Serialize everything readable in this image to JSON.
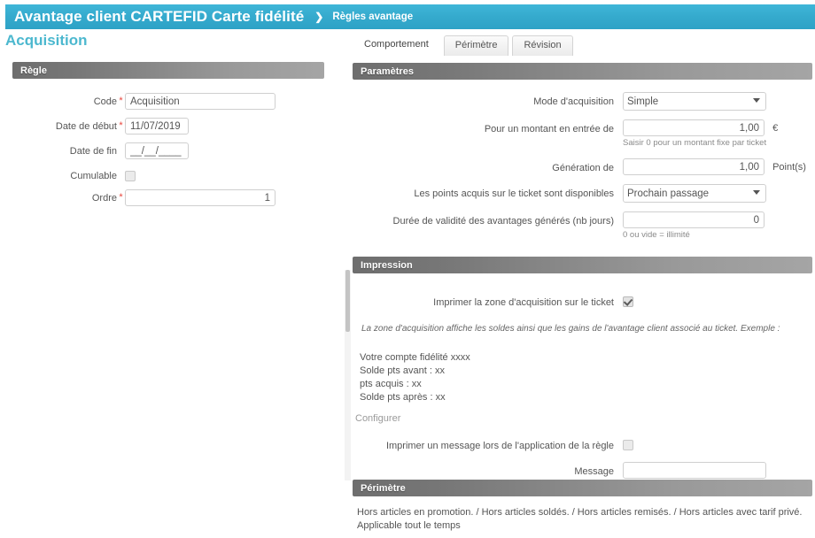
{
  "topbar": {
    "title": "Avantage client CARTEFID Carte fidélité",
    "separator": "❯",
    "breadcrumb": "Règles avantage"
  },
  "page": {
    "title": "Acquisition"
  },
  "tabs": [
    {
      "label": "Comportement",
      "active": true
    },
    {
      "label": "Périmètre",
      "active": false
    },
    {
      "label": "Révision",
      "active": false
    }
  ],
  "rule_panel": {
    "header": "Règle",
    "fields": {
      "code_label": "Code",
      "code_value": "Acquisition",
      "date_debut_label": "Date de début",
      "date_debut_value": "11/07/2019",
      "date_fin_label": "Date de fin",
      "date_fin_value": "__/__/____",
      "cumulable_label": "Cumulable",
      "ordre_label": "Ordre",
      "ordre_value": "1"
    },
    "required_marker": "*"
  },
  "parametres_panel": {
    "header": "Paramètres",
    "mode_label": "Mode d'acquisition",
    "mode_value": "Simple",
    "montant_label": "Pour un montant en entrée de",
    "montant_value": "1,00",
    "montant_unit": "€",
    "montant_hint": "Saisir 0 pour un montant fixe par ticket",
    "generation_label": "Génération de",
    "generation_value": "1,00",
    "generation_unit": "Point(s)",
    "disponibles_label": "Les points acquis sur le ticket sont disponibles",
    "disponibles_value": "Prochain passage",
    "duree_label": "Durée de validité des avantages générés (nb jours)",
    "duree_value": "0",
    "duree_hint": "0 ou vide = illimité"
  },
  "impression_panel": {
    "header": "Impression",
    "imprimer_zone_label": "Imprimer la zone d'acquisition sur le ticket",
    "imprimer_zone_checked": true,
    "note": "La zone d'acquisition affiche les soldes ainsi que les gains de l'avantage client associé au ticket. Exemple :",
    "sample_lines": [
      "Votre compte fidélité xxxx",
      "Solde pts avant : xx",
      "pts acquis : xx",
      "Solde pts après : xx"
    ],
    "configurer_link": "Configurer",
    "imprimer_message_label": "Imprimer un message lors de l'application de la règle",
    "imprimer_message_checked": false,
    "message_label": "Message",
    "message_value": "",
    "message_placeholder": ""
  },
  "perimetre_panel": {
    "header": "Périmètre",
    "line1": "Hors articles en promotion. / Hors articles soldés. / Hors articles remisés. / Hors articles avec tarif privé.",
    "line2": "Applicable tout le temps"
  },
  "colors": {
    "accent_blue": "#35aacd",
    "title_teal": "#4cb8cf",
    "panel_gray_dark": "#6e6e6e",
    "panel_gray_light": "#a5a5a5",
    "required_red": "#e8453c",
    "text": "#555555"
  }
}
